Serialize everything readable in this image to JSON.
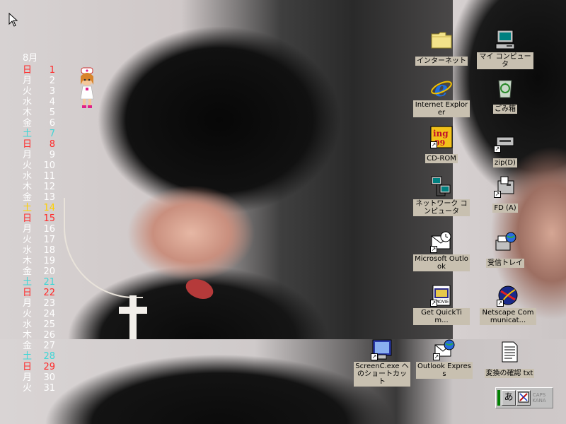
{
  "calendar": {
    "month": "8月",
    "days": [
      {
        "wd": "日",
        "d": "1",
        "color": "red"
      },
      {
        "wd": "月",
        "d": "2",
        "color": "white"
      },
      {
        "wd": "火",
        "d": "3",
        "color": "white"
      },
      {
        "wd": "水",
        "d": "4",
        "color": "white"
      },
      {
        "wd": "木",
        "d": "5",
        "color": "white"
      },
      {
        "wd": "金",
        "d": "6",
        "color": "white"
      },
      {
        "wd": "土",
        "d": "7",
        "color": "cyan"
      },
      {
        "wd": "日",
        "d": "8",
        "color": "red"
      },
      {
        "wd": "月",
        "d": "9",
        "color": "white"
      },
      {
        "wd": "火",
        "d": "10",
        "color": "white"
      },
      {
        "wd": "水",
        "d": "11",
        "color": "white"
      },
      {
        "wd": "木",
        "d": "12",
        "color": "white"
      },
      {
        "wd": "金",
        "d": "13",
        "color": "white"
      },
      {
        "wd": "土",
        "d": "14",
        "color": "yellow"
      },
      {
        "wd": "日",
        "d": "15",
        "color": "red"
      },
      {
        "wd": "月",
        "d": "16",
        "color": "white"
      },
      {
        "wd": "火",
        "d": "17",
        "color": "white"
      },
      {
        "wd": "水",
        "d": "18",
        "color": "white"
      },
      {
        "wd": "木",
        "d": "19",
        "color": "white"
      },
      {
        "wd": "金",
        "d": "20",
        "color": "white"
      },
      {
        "wd": "土",
        "d": "21",
        "color": "cyan"
      },
      {
        "wd": "日",
        "d": "22",
        "color": "red"
      },
      {
        "wd": "月",
        "d": "23",
        "color": "white"
      },
      {
        "wd": "火",
        "d": "24",
        "color": "white"
      },
      {
        "wd": "水",
        "d": "25",
        "color": "white"
      },
      {
        "wd": "木",
        "d": "26",
        "color": "white"
      },
      {
        "wd": "金",
        "d": "27",
        "color": "white"
      },
      {
        "wd": "土",
        "d": "28",
        "color": "cyan"
      },
      {
        "wd": "日",
        "d": "29",
        "color": "red"
      },
      {
        "wd": "月",
        "d": "30",
        "color": "white"
      },
      {
        "wd": "火",
        "d": "31",
        "color": "white"
      }
    ]
  },
  "icons": {
    "internet": "インターネット",
    "mycomputer": "マイ コンピュータ",
    "ie": "Internet Explorer",
    "recycle": "ごみ箱",
    "cdrom": "CD-ROM",
    "zip": "zip(D)",
    "network": "ネットワーク コンピュータ",
    "fd": "FD (A)",
    "outlook": "Microsoft Outlook",
    "inbox": "受信トレイ",
    "quicktime": "Get QuickTim...",
    "netscape": "Netscape Communicat...",
    "screenc": "ScreenC.exe へのショートカット",
    "outlookexpress": "Outlook Express",
    "henkan": "変換の確認 txt"
  },
  "imebar": {
    "mode": "あ",
    "caps": "CAPS",
    "kana": "KANA"
  },
  "colors": {
    "sunday": "#ff2a2a",
    "saturday": "#3fd6d6",
    "holiday": "#ffd000",
    "weekday": "#ffffff",
    "icon_label_bg": "#c8c0b0"
  }
}
